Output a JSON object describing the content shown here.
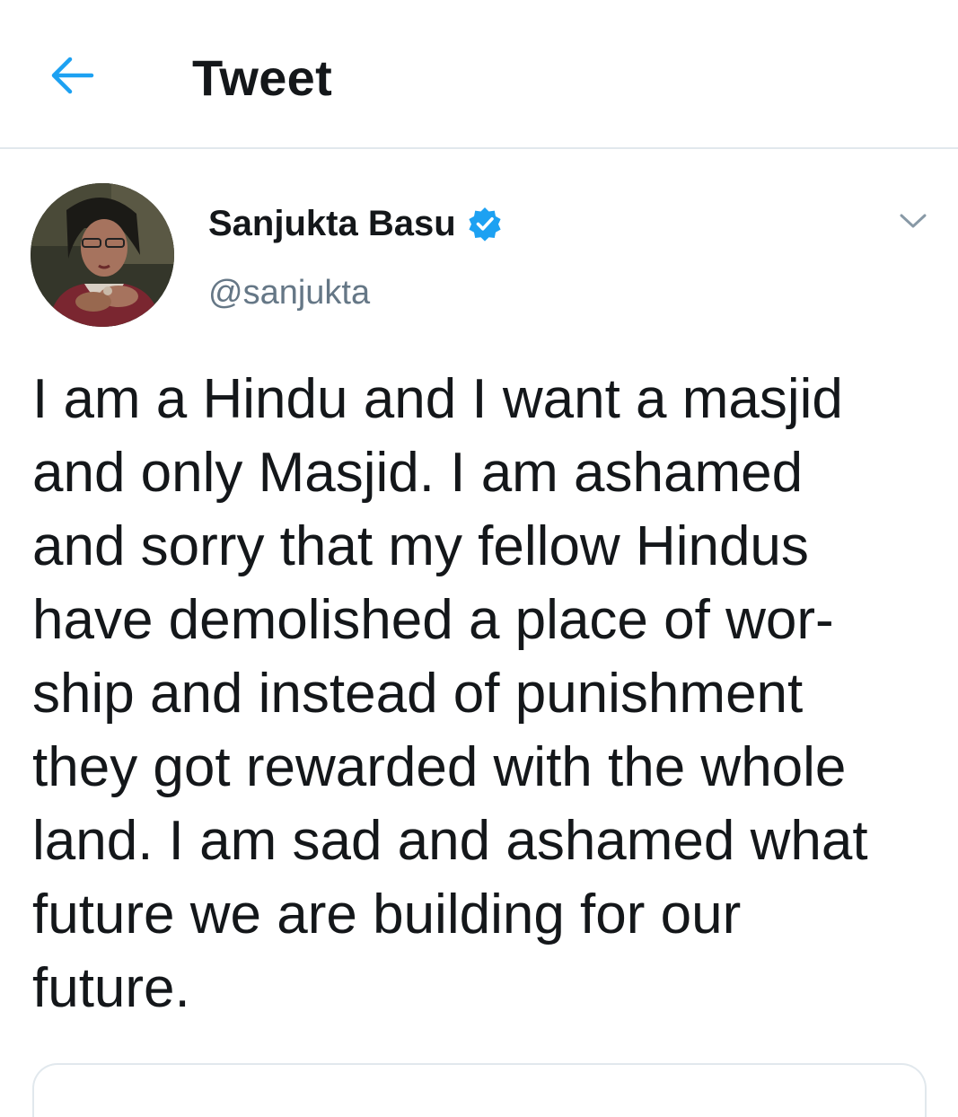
{
  "header": {
    "title": "Tweet",
    "back_icon": "arrow-left-icon",
    "accent_color": "#1da1f2"
  },
  "tweet": {
    "author": {
      "display_name": "Sanjukta Basu",
      "handle": "@sanjukta",
      "verified": true,
      "verified_icon": "verified-badge-icon"
    },
    "menu_icon": "chevron-down-icon",
    "text_lines": [
      "I am a Hindu and I want a masjid",
      "and only Masjid. I am ashamed",
      "and sorry that my fellow Hindus",
      "have demolished a place of wor-",
      "ship and instead of punishment",
      "they got rewarded with the whole",
      "land. I am sad and ashamed what",
      "future we are building for our",
      "future."
    ]
  },
  "colors": {
    "text_primary": "#14171a",
    "text_secondary": "#657786",
    "divider": "#e1e8ed",
    "verified_blue": "#1da1f2"
  }
}
